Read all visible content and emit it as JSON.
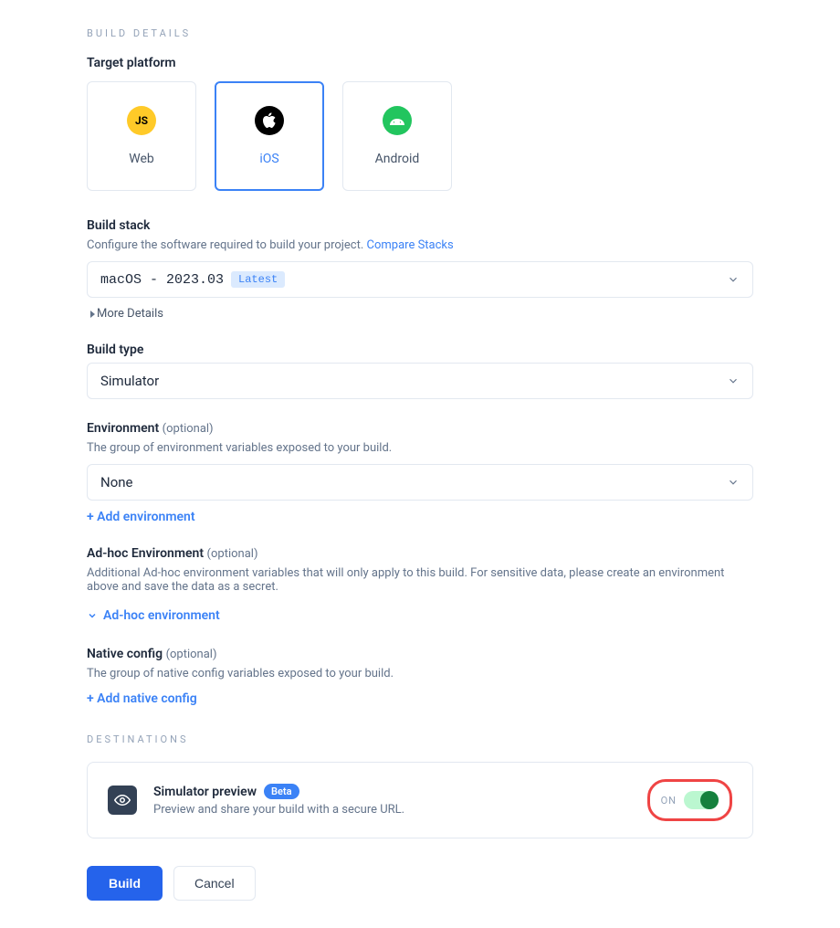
{
  "section_headers": {
    "build_details": "BUILD DETAILS",
    "destinations": "DESTINATIONS"
  },
  "target_platform": {
    "label": "Target platform",
    "options": [
      {
        "name": "Web"
      },
      {
        "name": "iOS"
      },
      {
        "name": "Android"
      }
    ]
  },
  "build_stack": {
    "label": "Build stack",
    "help": "Configure the software required to build your project. ",
    "compare_link": "Compare Stacks",
    "value": "macOS - 2023.03",
    "badge": "Latest",
    "more_details": "More Details"
  },
  "build_type": {
    "label": "Build type",
    "value": "Simulator"
  },
  "environment": {
    "label": "Environment",
    "optional": "(optional)",
    "help": "The group of environment variables exposed to your build.",
    "value": "None",
    "add_link": "+ Add environment"
  },
  "adhoc": {
    "label": "Ad-hoc Environment",
    "optional": "(optional)",
    "help": "Additional Ad-hoc environment variables that will only apply to this build. For sensitive data, please create an environment above and save the data as a secret.",
    "expand_link": "Ad-hoc environment"
  },
  "native_config": {
    "label": "Native config",
    "optional": "(optional)",
    "help": "The group of native config variables exposed to your build.",
    "add_link": "+ Add native config"
  },
  "simulator_preview": {
    "title": "Simulator preview",
    "badge": "Beta",
    "desc": "Preview and share your build with a secure URL.",
    "toggle_label": "ON"
  },
  "buttons": {
    "build": "Build",
    "cancel": "Cancel"
  },
  "icons": {
    "js": "JS"
  }
}
